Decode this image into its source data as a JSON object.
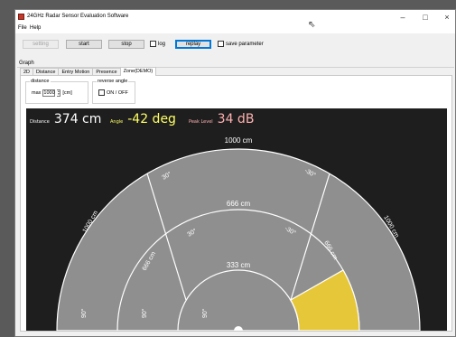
{
  "window": {
    "title": "24GHz Radar Sensor Evaluation Software",
    "controls": [
      "–",
      "□",
      "×"
    ]
  },
  "menu": [
    "File",
    "Help"
  ],
  "toolbar": {
    "setting": "setting",
    "start": "start",
    "stop": "stop",
    "log": "log",
    "replay": "replay",
    "save_parameter": "save parameter"
  },
  "graph_label": "Graph",
  "tabs": [
    "2D",
    "Distance",
    "Entry Motion",
    "Presence",
    "Zone(DEMO)"
  ],
  "distance_group": {
    "title": "distance",
    "max_label": "max",
    "max_value": "1000",
    "unit": "[cm]"
  },
  "reverse_group": {
    "title": "reverse angle",
    "option": "ON / OFF"
  },
  "readouts": {
    "distance_label": "Distance",
    "distance_value": "374 cm",
    "angle_label": "Angle",
    "angle_value": "-42 deg",
    "peak_label": "Peak Level",
    "peak_value": "34 dB"
  },
  "colors": {
    "distance_value": "#ffffff",
    "angle": "#ffff66",
    "peak": "#ffb0b0",
    "zone": "#8f8f8f",
    "zone_highlight": "#e6c739",
    "background": "#1e1e1e",
    "lines": "#ffffff"
  },
  "zone": {
    "rings": [
      {
        "label": "333 cm",
        "radius_cm": 333
      },
      {
        "label": "666 cm",
        "radius_cm": 666
      },
      {
        "label": "1000 cm",
        "radius_cm": 1000
      }
    ],
    "angle_labels": {
      "outer": [
        "90°",
        "1000 cm",
        "30°",
        "-30°",
        "1000 cm"
      ],
      "middle": [
        "90°",
        "666 cm",
        "30°",
        "-30°",
        "666 cm"
      ],
      "inner": [
        "90°"
      ]
    },
    "highlighted_sector": {
      "ring": 2,
      "from_deg": -30,
      "to_deg": -90
    }
  }
}
